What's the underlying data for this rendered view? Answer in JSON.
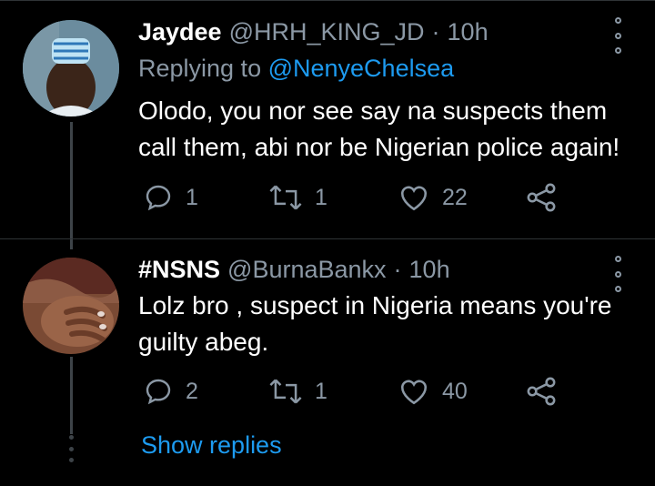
{
  "tweets": [
    {
      "name": "Jaydee",
      "handle": "@HRH_KING_JD",
      "dot": "·",
      "time": "10h",
      "replying_prefix": "Replying to ",
      "replying_to": "@NenyeChelsea",
      "body_line1": "Olodo, you nor see say na suspects them",
      "body_line2": "call them, abi nor be Nigerian police again!",
      "replies": "1",
      "retweets": "1",
      "likes": "22"
    },
    {
      "name": "#NSNS",
      "handle": "@BurnaBankx",
      "dot": "·",
      "time": "10h",
      "body_line1": "Lolz bro , suspect in Nigeria means you're",
      "body_line2": "guilty abeg.",
      "replies": "2",
      "retweets": "1",
      "likes": "40"
    }
  ],
  "show_replies": "Show replies",
  "colors": {
    "background": "#000000",
    "accent": "#1d9bf0",
    "muted": "#8b98a5"
  },
  "icons": [
    "reply-icon",
    "retweet-icon",
    "like-icon",
    "share-icon",
    "more-options-icon"
  ]
}
